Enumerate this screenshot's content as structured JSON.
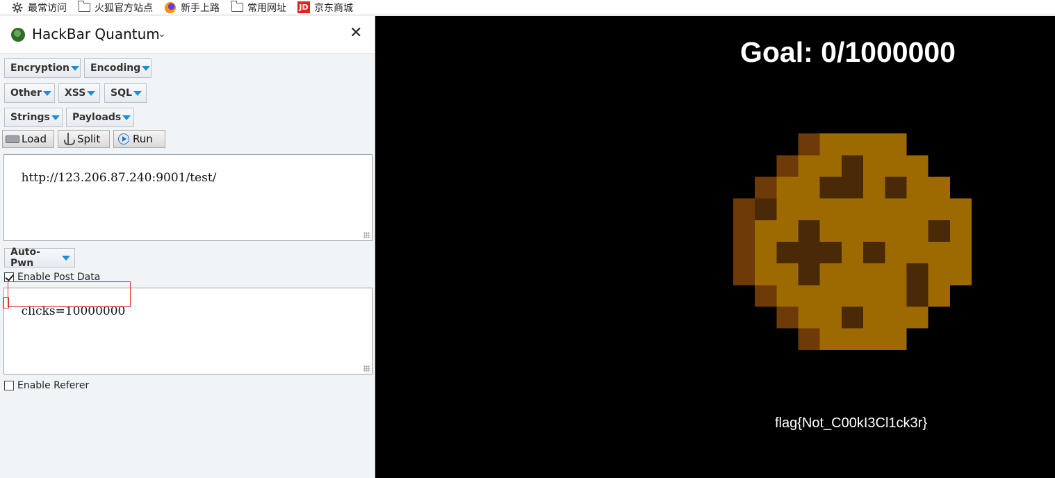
{
  "bookmarks": [
    {
      "label": "最常访问",
      "icon": "gear-icon"
    },
    {
      "label": "火狐官方站点",
      "icon": "folder-icon"
    },
    {
      "label": "新手上路",
      "icon": "firefox-icon"
    },
    {
      "label": "常用网址",
      "icon": "folder-icon"
    },
    {
      "label": "京东商城",
      "icon": "jd-icon",
      "icon_text": "JD"
    }
  ],
  "hackbar": {
    "title": "HackBar Quantum",
    "menus": {
      "encryption": "Encryption",
      "encoding": "Encoding",
      "other": "Other",
      "xss": "XSS",
      "sql": "SQL",
      "strings": "Strings",
      "payloads": "Payloads",
      "autopwn": "Auto-Pwn"
    },
    "tools": {
      "load": "Load",
      "split": "Split",
      "run": "Run"
    },
    "url_value": "http://123.206.87.240:9001/test/",
    "enable_post_label": "Enable Post Data",
    "enable_post_checked": true,
    "post_value": "clicks=10000000",
    "enable_referer_label": "Enable Referer",
    "enable_referer_checked": false
  },
  "game": {
    "goal_text": "Goal: 0/1000000",
    "flag_text": "flag{Not_C00kI3Cl1ck3r}"
  },
  "colors": {
    "cookie_main": "#9c6a00",
    "cookie_dark": "#4a2906",
    "cookie_edge": "#6e3a08",
    "accent_triangle": "#1a8ddb",
    "annotation_red": "#e03030"
  }
}
